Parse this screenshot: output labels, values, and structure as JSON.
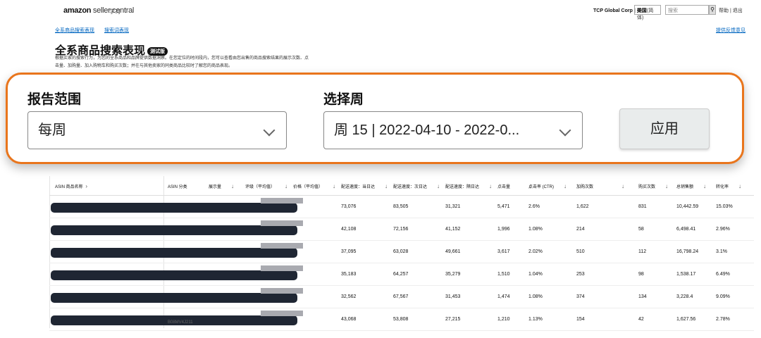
{
  "header": {
    "logo_brand": "amazon",
    "logo_suffix": "seller central",
    "logo_sub": "学习",
    "account": "TCP Global Corp | 美国",
    "language": "中文(简体)",
    "search_placeholder": "搜索",
    "search_icon": "search-icon",
    "help": "帮助 | 退出"
  },
  "subnav": {
    "items": [
      "全系商品搜索表现",
      "搜索词表现"
    ],
    "feedback": "提供反馈意见"
  },
  "page": {
    "title": "全系商品搜索表现",
    "beta": "测试版",
    "description": "根据买家的搜索行为，为您的全系商品和品牌提供数据洞察。在您定位的时间段内，您可以查看由您出售的商品搜索结果的展示次数、点击量、加购量、加入购物车和购买次数；并在与其他卖家的同类商品比较时了解您的商品表现。"
  },
  "filters": {
    "range_label": "报告范围",
    "range_value": "每周",
    "week_label": "选择周",
    "week_value": "周 15 | 2022-04-10 - 2022-0...",
    "apply_label": "应用",
    "chevron_icon": "chevron-down-icon",
    "highlight_color": "#e9751c"
  },
  "table": {
    "columns": [
      "ASIN 商品名称",
      "ASIN 分类",
      "展示量",
      "评级（平均值）",
      "价格（平均值）",
      "配送速度：当日达",
      "配送速度：次日达",
      "配送速度：隔日达",
      "点击量",
      "点击率 (CTR)",
      "加购次数",
      "购买次数",
      "总销售额",
      "转化率"
    ],
    "rows": [
      {
        "redacted": true,
        "c1": "73,076",
        "c2": "83,505",
        "c3": "31,321",
        "c4": "5,471",
        "c5": "2.6%",
        "c6": "1,622",
        "c7": "831",
        "c8": "10,442.59",
        "c9": "15.03%"
      },
      {
        "redacted": true,
        "c1": "42,108",
        "c2": "72,156",
        "c3": "41,152",
        "c4": "1,996",
        "c5": "1.08%",
        "c6": "214",
        "c7": "58",
        "c8": "6,498.41",
        "c9": "2.96%"
      },
      {
        "redacted": true,
        "c1": "37,095",
        "c2": "63,028",
        "c3": "49,661",
        "c4": "3,617",
        "c5": "2.02%",
        "c6": "510",
        "c7": "112",
        "c8": "16,798.24",
        "c9": "3.1%"
      },
      {
        "redacted": true,
        "c1": "35,183",
        "c2": "64,257",
        "c3": "35,279",
        "c4": "1,510",
        "c5": "1.04%",
        "c6": "253",
        "c7": "98",
        "c8": "1,538.17",
        "c9": "6.49%"
      },
      {
        "redacted": true,
        "c1": "32,562",
        "c2": "67,567",
        "c3": "31,453",
        "c4": "1,474",
        "c5": "1.08%",
        "c6": "374",
        "c7": "134",
        "c8": "3,228.4",
        "c9": "9.09%"
      },
      {
        "redacted": true,
        "c1": "43,068",
        "c2": "53,808",
        "c3": "27,215",
        "c4": "1,210",
        "c5": "1.13%",
        "c6": "154",
        "c7": "42",
        "c8": "1,627.56",
        "c9": "2.78%"
      }
    ],
    "footer_text": "B08MV4J211"
  }
}
